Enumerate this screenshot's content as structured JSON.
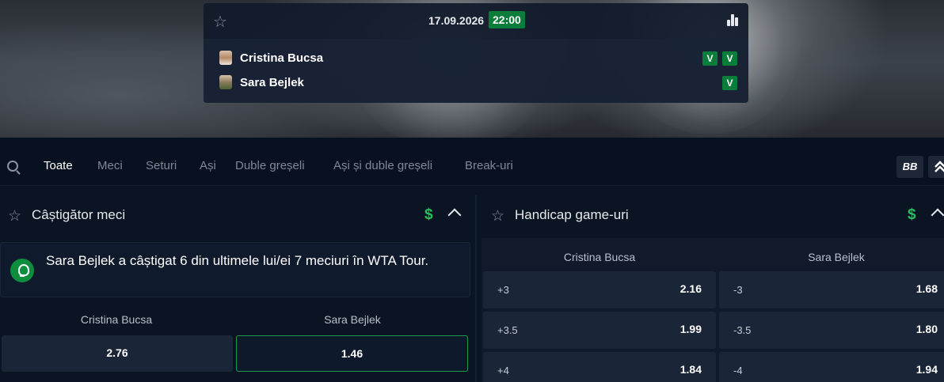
{
  "match": {
    "date": "17.09.2026",
    "time": "22:00",
    "players": [
      {
        "name": "Cristina Bucsa",
        "form": [
          "V",
          "V"
        ]
      },
      {
        "name": "Sara Bejlek",
        "form": [
          "V"
        ]
      }
    ]
  },
  "filters": {
    "tabs": [
      "Toate",
      "Meci",
      "Seturi",
      "Ași",
      "Duble greșeli",
      "Ași și duble greșeli",
      "Break-uri"
    ],
    "active": "Toate",
    "layout_button": "BB"
  },
  "winner_market": {
    "title": "Câștigător meci",
    "insight": "Sara Bejlek a câștigat 6 din ultimele lui/ei 7 meciuri în WTA Tour.",
    "columns": [
      "Cristina Bucsa",
      "Sara Bejlek"
    ],
    "odds": [
      "2.76",
      "1.46"
    ]
  },
  "handicap_market": {
    "title": "Handicap game-uri",
    "columns": [
      "Cristina Bucsa",
      "Sara Bejlek"
    ],
    "rows": [
      {
        "left_line": "+3",
        "left_odd": "2.16",
        "right_line": "-3",
        "right_odd": "1.68"
      },
      {
        "left_line": "+3.5",
        "left_odd": "1.99",
        "right_line": "-3.5",
        "right_odd": "1.80"
      },
      {
        "left_line": "+4",
        "left_odd": "1.84",
        "right_line": "-4",
        "right_odd": "1.94"
      }
    ]
  },
  "colors": {
    "accent_green": "#0b7d3a",
    "dollar_green": "#21c45a",
    "background": "#0a1422"
  }
}
